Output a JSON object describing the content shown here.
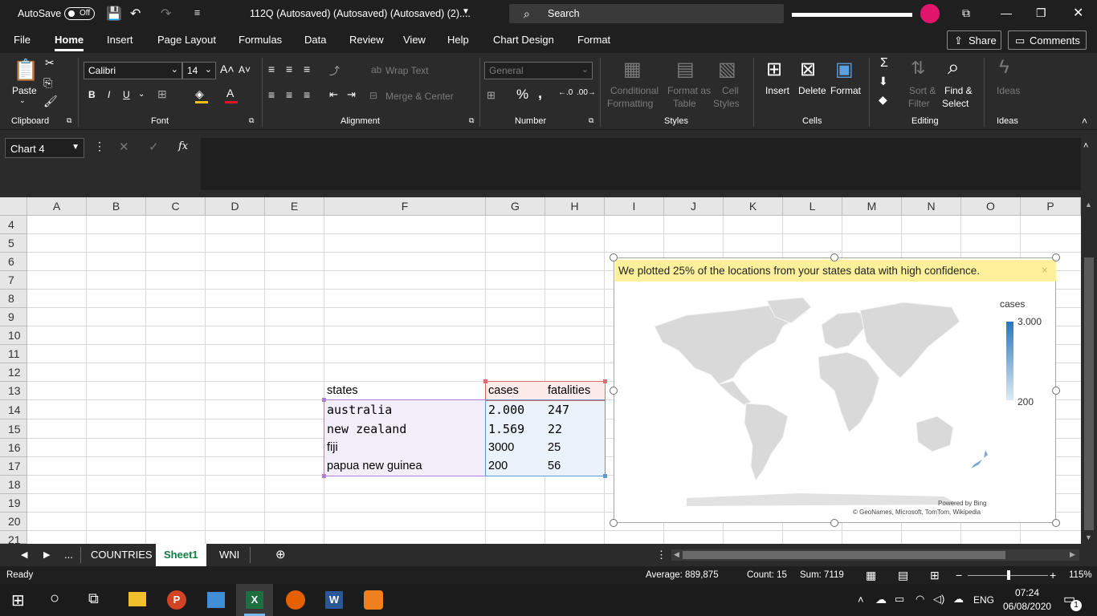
{
  "titlebar": {
    "autosave_label": "AutoSave",
    "autosave_state": "Off",
    "doc_title": "112Q (Autosaved) (Autosaved) (Autosaved) (2)....",
    "search_placeholder": "Search"
  },
  "menu": {
    "items": [
      "File",
      "Home",
      "Insert",
      "Page Layout",
      "Formulas",
      "Data",
      "Review",
      "View",
      "Help",
      "Chart Design",
      "Format"
    ],
    "active": "Home",
    "share_label": "Share",
    "comments_label": "Comments"
  },
  "ribbon": {
    "paste_label": "Paste",
    "font_name": "Calibri",
    "font_size": "14",
    "bold": "B",
    "italic": "I",
    "underline": "U",
    "wrap_text": "Wrap Text",
    "merge_center": "Merge & Center",
    "number_format": "General",
    "percent": "%",
    "comma": ",",
    "conditional_formatting_1": "Conditional",
    "conditional_formatting_2": "Formatting",
    "format_as_table_1": "Format as",
    "format_as_table_2": "Table",
    "cell_styles_1": "Cell",
    "cell_styles_2": "Styles",
    "insert_label": "Insert",
    "delete_label": "Delete",
    "format_label": "Format",
    "sort_filter_1": "Sort &",
    "sort_filter_2": "Filter",
    "find_select_1": "Find &",
    "find_select_2": "Select",
    "ideas_label": "Ideas",
    "groups": {
      "clipboard": "Clipboard",
      "font": "Font",
      "alignment": "Alignment",
      "number": "Number",
      "styles": "Styles",
      "cells": "Cells",
      "editing": "Editing",
      "ideas": "Ideas"
    }
  },
  "formula_bar": {
    "name_box": "Chart 4",
    "fx": "fx",
    "value": ""
  },
  "sheet": {
    "columns": [
      "A",
      "B",
      "C",
      "D",
      "E",
      "F",
      "G",
      "H",
      "I",
      "J",
      "K",
      "L",
      "M",
      "N",
      "O",
      "P"
    ],
    "rows": [
      "4",
      "5",
      "6",
      "7",
      "8",
      "9",
      "10",
      "11",
      "12",
      "13",
      "14",
      "15",
      "16",
      "17",
      "18",
      "19",
      "20",
      "21"
    ],
    "table": {
      "headers": [
        "states",
        "cases",
        "fatalities"
      ],
      "rows": [
        [
          "australia",
          "2.000",
          "247"
        ],
        [
          "new zealand",
          "1.569",
          "22"
        ],
        [
          "fiji",
          "3000",
          "25"
        ],
        [
          "papua new guinea",
          "200",
          "56"
        ]
      ]
    }
  },
  "chart": {
    "banner_text": "We plotted 25% of the locations from your states data with high confidence.",
    "legend_title": "cases",
    "legend_max": "3.000",
    "legend_min": "200",
    "credit_1": "Powered by Bing",
    "credit_2": "© GeoNames, Microsoft, TomTom, Wikipedia",
    "colors": {
      "scale_high": "#2e75b6",
      "scale_low": "#ddebf7",
      "land": "#d9d9d9"
    }
  },
  "tabs": {
    "more": "...",
    "sheets": [
      "COUNTRIES",
      "Sheet1",
      "WNI"
    ],
    "active": "Sheet1"
  },
  "status": {
    "ready": "Ready",
    "average": "Average: 889,875",
    "count": "Count: 15",
    "sum": "Sum: 7119",
    "zoom": "115%"
  },
  "taskbar": {
    "language": "ENG",
    "time": "07:24",
    "date": "06/08/2020",
    "notifications": "1"
  }
}
